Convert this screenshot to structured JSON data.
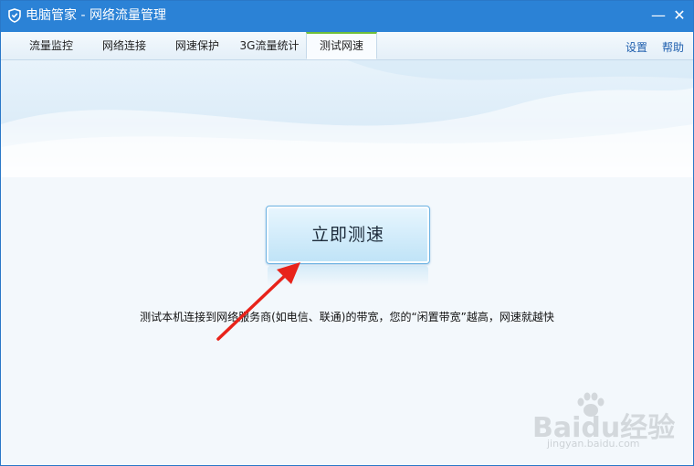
{
  "window": {
    "title": "电脑管家 - 网络流量管理",
    "minimize_glyph": "—",
    "close_glyph": "✕",
    "titlebar_color": "#2b82d6",
    "app_icon": "shield-icon"
  },
  "tabs": [
    {
      "label": "流量监控",
      "active": false
    },
    {
      "label": "网络连接",
      "active": false
    },
    {
      "label": "网速保护",
      "active": false
    },
    {
      "label": "3G流量统计",
      "active": false
    },
    {
      "label": "测试网速",
      "active": true
    }
  ],
  "links": {
    "settings": "设置",
    "help": "帮助"
  },
  "main": {
    "speed_test_button": "立即测速",
    "description": "测试本机连接到网络服务商(如电信、联通)的带宽，您的“闲置带宽”越高，网速就越快"
  },
  "annotation": {
    "arrow_color": "#e8231a"
  },
  "watermark": {
    "logo_text": "Baidu经验",
    "url_text": "jingyan.baidu.com"
  }
}
